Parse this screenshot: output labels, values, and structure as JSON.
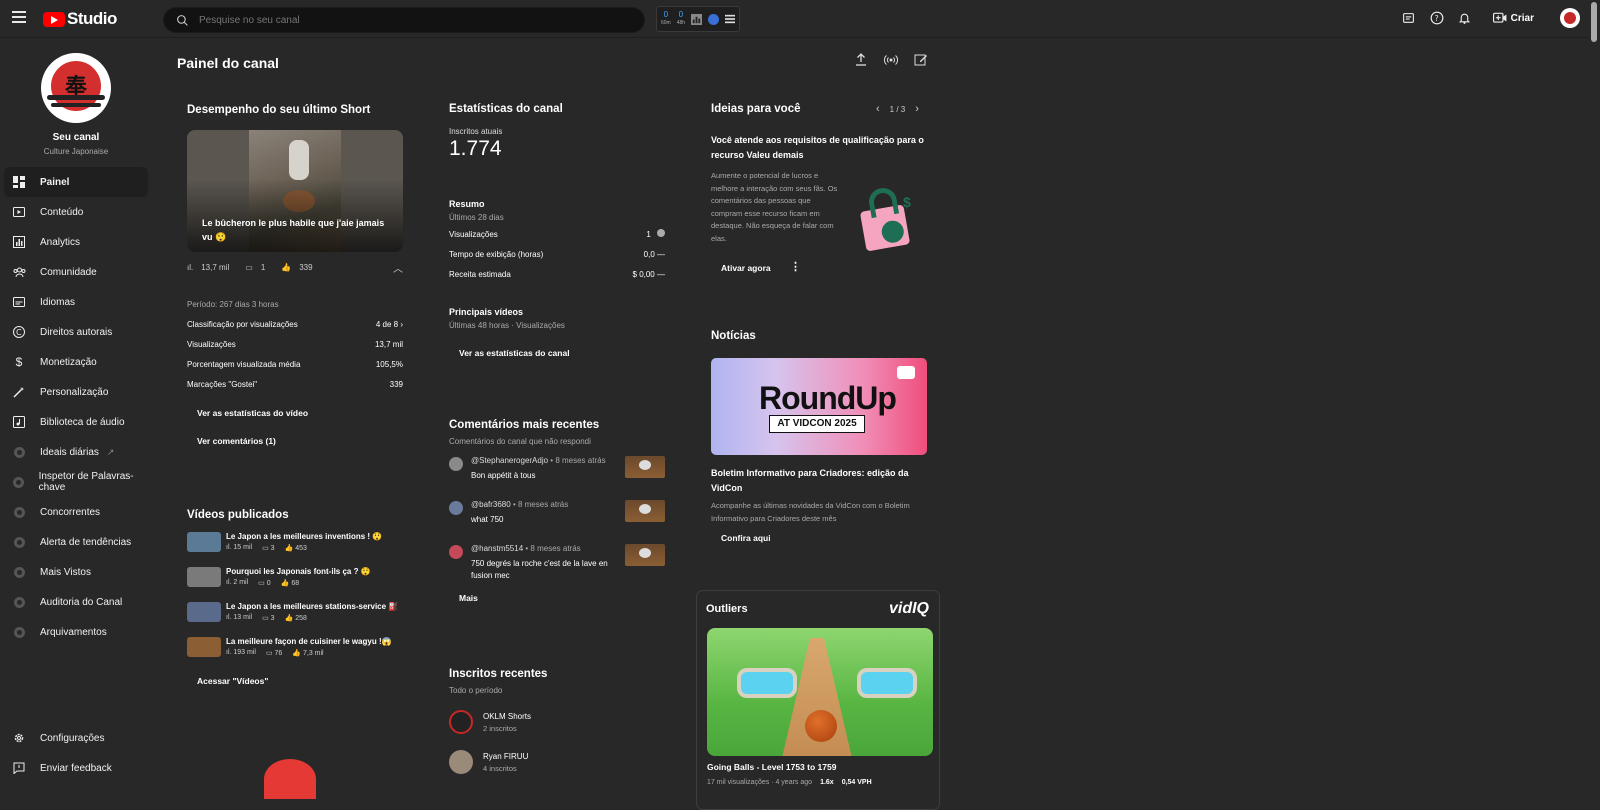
{
  "header": {
    "logo_text": "Studio",
    "search_placeholder": "Pesquise no seu canal",
    "ext_stats": [
      {
        "value": "0",
        "label": "60m"
      },
      {
        "value": "0",
        "label": "48h"
      }
    ],
    "create_label": "Criar"
  },
  "sidebar": {
    "channel_name": "Seu canal",
    "channel_sub": "Culture Japonaise",
    "channel_avatar_glyph": "奉",
    "items": [
      {
        "label": "Painel",
        "icon": "dashboard-icon",
        "active": true
      },
      {
        "label": "Conteúdo",
        "icon": "content-icon"
      },
      {
        "label": "Analytics",
        "icon": "analytics-icon"
      },
      {
        "label": "Comunidade",
        "icon": "community-icon"
      },
      {
        "label": "Idiomas",
        "icon": "subtitles-icon"
      },
      {
        "label": "Direitos autorais",
        "icon": "copyright-icon"
      },
      {
        "label": "Monetização",
        "icon": "dollar-icon"
      },
      {
        "label": "Personalização",
        "icon": "magic-wand-icon"
      },
      {
        "label": "Biblioteca de áudio",
        "icon": "audio-library-icon"
      },
      {
        "label": "Ideais diárias",
        "icon": "vidiq-icon",
        "external": true
      },
      {
        "label": "Inspetor de Palavras-chave",
        "icon": "vidiq-icon"
      },
      {
        "label": "Concorrentes",
        "icon": "vidiq-icon"
      },
      {
        "label": "Alerta de tendências",
        "icon": "vidiq-icon"
      },
      {
        "label": "Mais Vistos",
        "icon": "vidiq-icon"
      },
      {
        "label": "Auditoria do Canal",
        "icon": "vidiq-icon"
      },
      {
        "label": "Arquivamentos",
        "icon": "vidiq-icon"
      }
    ],
    "bottom_items": [
      {
        "label": "Configurações",
        "icon": "gear-icon"
      },
      {
        "label": "Enviar feedback",
        "icon": "feedback-icon"
      }
    ]
  },
  "page_title": "Painel do canal",
  "short": {
    "heading": "Desempenho do seu último Short",
    "caption": "Le bûcheron le plus habile que j'aie jamais vu 😲",
    "views": "13,7 mil",
    "comments": "1",
    "likes": "339",
    "period": "Período: 267 dias 3 horas",
    "rows": [
      {
        "label": "Classificação por visualizações",
        "value": "4 de 8"
      },
      {
        "label": "Visualizações",
        "value": "13,7 mil"
      },
      {
        "label": "Porcentagem visualizada média",
        "value": "105,5%"
      },
      {
        "label": "Marcações \"Gostei\"",
        "value": "339"
      }
    ],
    "link_stats": "Ver as estatísticas do vídeo",
    "link_comments": "Ver comentários (1)"
  },
  "published": {
    "heading": "Vídeos publicados",
    "videos": [
      {
        "title": "Le Japon a les meilleures inventions ! 😲",
        "views": "15 mil",
        "comments": "3",
        "likes": "453",
        "thumb": "#5a7a96"
      },
      {
        "title": "Pourquoi les Japonais font-ils ça ? 😲",
        "views": "2 mil",
        "comments": "0",
        "likes": "68",
        "thumb": "#7a7a7a"
      },
      {
        "title": "Le Japon a les meilleures stations-service ⛽",
        "views": "13 mil",
        "comments": "3",
        "likes": "258",
        "thumb": "#5a6a8a"
      },
      {
        "title": "La meilleure façon de cuisiner le wagyu !😱",
        "views": "193 mil",
        "comments": "76",
        "likes": "7,3 mil",
        "thumb": "#8b5e34"
      }
    ],
    "link": "Acessar \"Vídeos\""
  },
  "stats": {
    "heading": "Estatísticas do canal",
    "subs_label": "Inscritos atuais",
    "subs_value": "1.774",
    "summary_heading": "Resumo",
    "summary_period": "Últimos 28 dias",
    "rows": [
      {
        "label": "Visualizações",
        "value": "1"
      },
      {
        "label": "Tempo de exibição (horas)",
        "value": "0,0"
      },
      {
        "label": "Receita estimada",
        "value": "$ 0,00"
      }
    ],
    "top_heading": "Principais vídeos",
    "top_sub": "Últimas 48 horas · Visualizações",
    "link": "Ver as estatísticas do canal"
  },
  "comments": {
    "heading": "Comentários mais recentes",
    "sub": "Comentários do canal que não respondi",
    "items": [
      {
        "author": "@StephanerogerAdjo",
        "time": "• 8 meses atrás",
        "text": "Bon appétit à tous",
        "avatar": "#8a8a8a"
      },
      {
        "author": "@bafr3680",
        "time": "• 8 meses atrás",
        "text": "what 750",
        "avatar": "#6a7a9a"
      },
      {
        "author": "@hanstm5514",
        "time": "• 8 meses atrás",
        "text": "750 degrés la roche c'est de la lave en fusion mec",
        "avatar": "#c44a5a"
      }
    ],
    "more": "Mais"
  },
  "recent_subs": {
    "heading": "Inscritos recentes",
    "sub": "Todo o período",
    "items": [
      {
        "name": "OKLM Shorts",
        "count": "2 inscritos",
        "avatar": "#222"
      },
      {
        "name": "Ryan FIRUU",
        "count": "4 inscritos",
        "avatar": "#9a8a7a"
      }
    ]
  },
  "ideas": {
    "heading": "Ideias para você",
    "pager": "1 / 3",
    "title": "Você atende aos requisitos de qualificação para o recurso Valeu demais",
    "body": "Aumente o potencial de lucros e melhore a interação com seus fãs. Os comentários das pessoas que compram esse recurso ficam em destaque. Não esqueça de falar com elas.",
    "cta": "Ativar agora"
  },
  "news": {
    "heading": "Notícias",
    "banner_title": "RoundUp",
    "banner_sub": "AT VIDCON 2025",
    "title": "Boletim Informativo para Criadores: edição da VidCon",
    "body": "Acompanhe as últimas novidades da VidCon com o Boletim Informativo para Criadores deste mês",
    "cta": "Confira aqui"
  },
  "outliers": {
    "heading": "Outliers",
    "brand": "vidIQ",
    "video_title": "Going Balls - Level 1753 to 1759",
    "meta": "17 mil visualizações · 4 years ago",
    "multiplier": "1.6x",
    "vph": "0,54 VPH"
  }
}
